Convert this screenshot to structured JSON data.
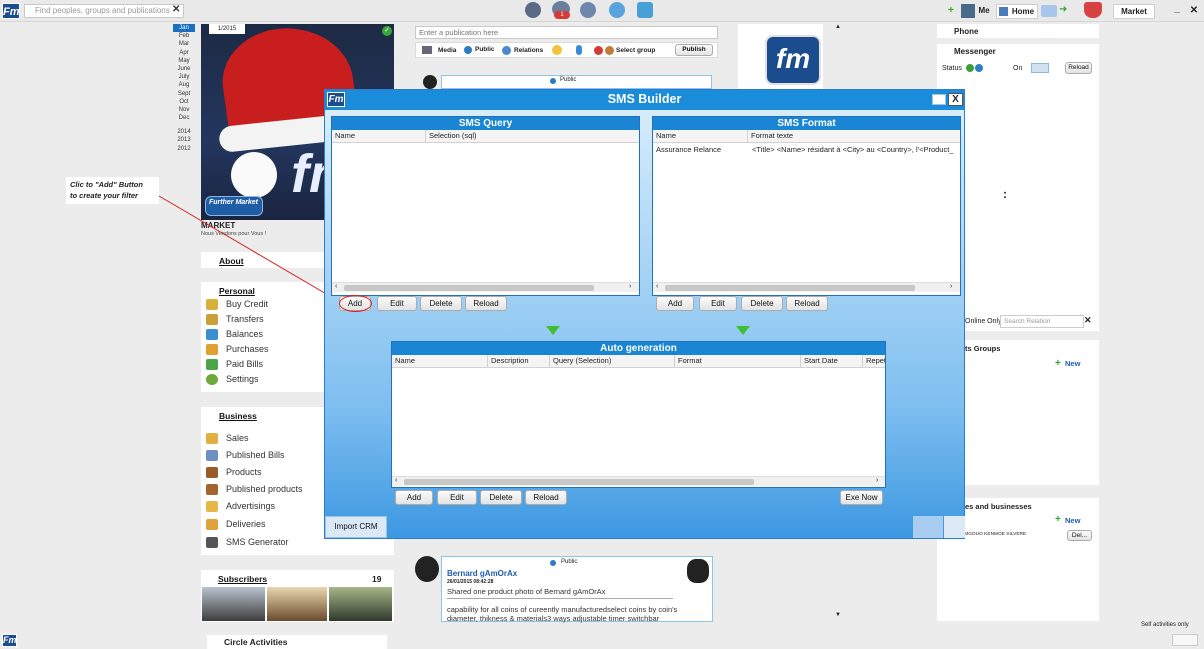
{
  "topbar": {
    "logo": "Fm",
    "search_placeholder": "Find peoples, groups and publications",
    "search_clear": "✕",
    "notification_badge": "1",
    "me_label": "Me",
    "home_label": "Home",
    "market_label": "Market",
    "minimize": "_",
    "close": "✕"
  },
  "left": {
    "calendar_year_tag": "1/2015",
    "months": [
      "Jan",
      "Feb",
      "Mar",
      "Apr",
      "May",
      "June",
      "July",
      "Aug",
      "Sept",
      "Oct",
      "Nov",
      "Dec"
    ],
    "years": [
      "2014",
      "2013",
      "2012"
    ],
    "profile_logo": "fm",
    "profile_badge": "Further Market",
    "market_name": "MARKET",
    "market_slogan": "Nous Vendons pour Vous !",
    "about": "About",
    "personal_title": "Personal",
    "personal_items": [
      "Buy Credit",
      "Transfers",
      "Balances",
      "Purchases",
      "Paid Bills",
      "Settings"
    ],
    "business_title": "Business",
    "business_items": [
      "Sales",
      "Published Bills",
      "Products",
      "Published products",
      "Advertisings",
      "Deliveries",
      "SMS Generator"
    ],
    "subscribers_title": "Subscribers",
    "subscribers_count": "19",
    "circle_activities": "Circle Activities"
  },
  "annotation": {
    "line1": "Clic to \"Add\" Button",
    "line2": "to create your filter"
  },
  "center": {
    "publication_placeholder": "Enter a publication here",
    "media": "Media",
    "public": "Public",
    "relations": "Relations",
    "select_group": "Select group",
    "publish": "Publish",
    "post_visibility": "Public",
    "post2_visibility": "Public",
    "post2_author": "Bernard gAmOrAx",
    "post2_date": "26/01/2015 08:42:28",
    "post2_text": "Shared one product photo of  Bernard gAmOrAx",
    "post2_body": "capability for all coins of cureently manufacturedselect coins by coin's diameter, thikness & materials3 ways adjustable timer switchbar"
  },
  "right": {
    "phone": "Phone",
    "messenger": "Messenger",
    "status_label": "Status",
    "on_label": "On",
    "reload": "Reload",
    "dots": ":",
    "online_only": "Online Only",
    "search_relation_placeholder": "Search Relation",
    "search_clear": "✕",
    "groups_title": "ts Groups",
    "new_label": "New",
    "businesses_title": "es and businesses",
    "new_label2": "New",
    "business_person": "DOMGOUO KENMOE SILVERE",
    "delete_short": "Del...",
    "self_activities": "Self activities only"
  },
  "dialog": {
    "title": "SMS Builder",
    "restore": "",
    "close": "X",
    "sms_query": {
      "title": "SMS Query",
      "columns": [
        "Name",
        "Selection (sql)"
      ],
      "buttons": [
        "Add",
        "Edit",
        "Delete",
        "Reload"
      ]
    },
    "sms_format": {
      "title": "SMS Format",
      "columns": [
        "Name",
        "Format texte"
      ],
      "rows": [
        [
          "Assurance Relance",
          "<Title>  <Name> résidant à <City> au <Country>, l'<Product_"
        ]
      ],
      "buttons": [
        "Add",
        "Edit",
        "Delete",
        "Reload"
      ]
    },
    "auto_generation": {
      "title": "Auto generation",
      "columns": [
        "Name",
        "Description",
        "Query (Selection)",
        "Format",
        "Start Date",
        "Repet"
      ],
      "buttons": [
        "Add",
        "Edit",
        "Delete",
        "Reload"
      ],
      "exe_now": "Exe Now"
    },
    "import_crm": "Import CRM"
  },
  "colors": {
    "title_bar": "#1a8cda",
    "box_header": "#1a86d3",
    "arrow": "#3fbf2f",
    "annotation": "#d62020"
  }
}
